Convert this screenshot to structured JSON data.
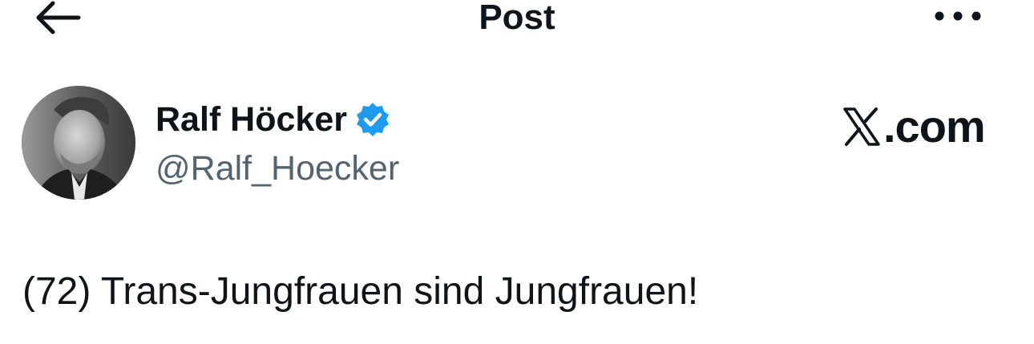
{
  "header": {
    "back_icon": "arrow-left-icon",
    "title": "Post",
    "more_icon": "more-dots-icon"
  },
  "author": {
    "display_name": "Ralf Höcker",
    "handle": "@Ralf_Hoecker",
    "verified_icon": "verified-badge-icon",
    "verified_color": "#1d9bf0"
  },
  "site_badge": {
    "logo_icon": "x-logo-icon",
    "text": ".com"
  },
  "post": {
    "text": "(72) Trans-Jungfrauen sind Jungfrauen!"
  },
  "colors": {
    "text_primary": "#0f1419",
    "text_secondary": "#536471",
    "accent": "#1d9bf0"
  }
}
